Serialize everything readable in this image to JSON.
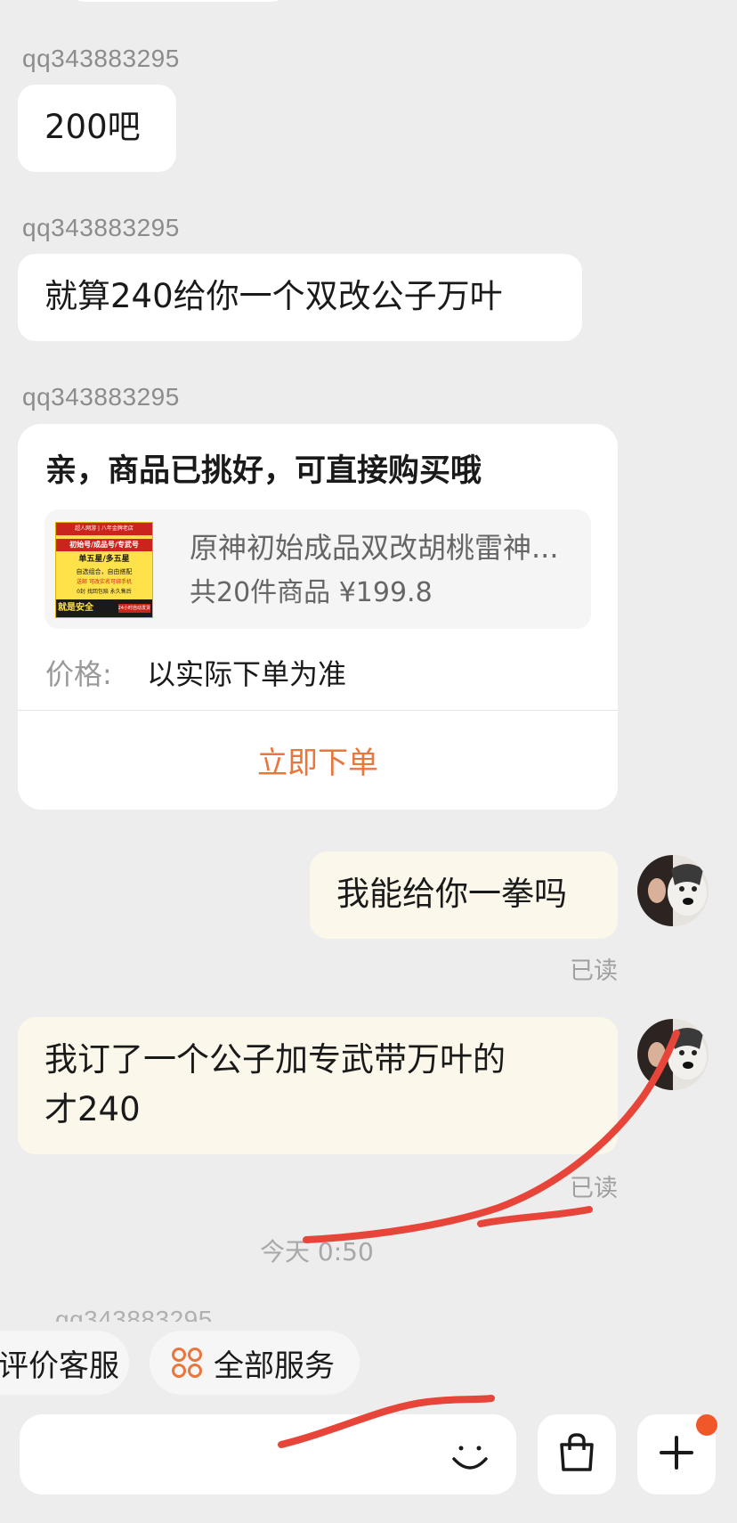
{
  "messages": [
    {
      "sender": "qq343883295",
      "text": "200吧"
    },
    {
      "sender": "qq343883295",
      "text": "就算240给你一个双改公子万叶"
    }
  ],
  "product_card": {
    "sender": "qq343883295",
    "title": "亲，商品已挑好，可直接购买哦",
    "product_name": "原神初始成品双改胡桃雷神...",
    "product_meta": "共20件商品 ¥199.8",
    "price_label": "价格:",
    "price_value": "以实际下单为准",
    "order_button": "立即下单",
    "thumbnail": {
      "line1": "超人网游 | 八年金牌老店",
      "line2": "初始号/成品号/专武号",
      "line3": "单五星/多五星",
      "line4": "自选组合，自由搭配",
      "line5": "送邮 可改实名可绑手机",
      "line6": "0封 找回包赔 永久售后",
      "line7": "就是安全",
      "line8": "24小时自动发货"
    }
  },
  "my_messages": [
    {
      "text": "我能给你一拳吗",
      "status": "已读"
    },
    {
      "text_line1": "我订了一个公子加专武带万叶的",
      "text_line2": "才240",
      "status": "已读"
    }
  ],
  "timestamp": "今天 0:50",
  "quick_actions": [
    {
      "label": "评价客服"
    },
    {
      "label": "全部服务",
      "icon": "grid-icon"
    }
  ],
  "input": {
    "placeholder": ""
  },
  "icons": {
    "emoji": "smile-icon",
    "shop": "shopping-bag-icon",
    "more": "plus-icon"
  },
  "colors": {
    "accent": "#e8763d",
    "mine_bubble": "#fbf8eb",
    "badge": "#f0582a",
    "annotation": "#e8453a"
  }
}
